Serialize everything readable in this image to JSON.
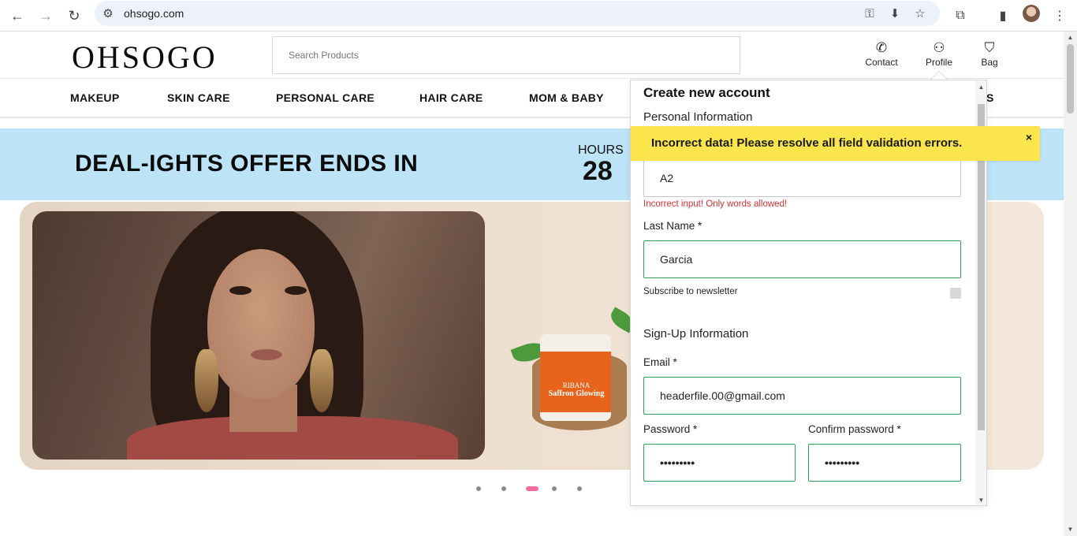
{
  "browser": {
    "url": "ohsogo.com"
  },
  "site": {
    "logo": "OHSOGO",
    "search_placeholder": "Search Products",
    "header_links": [
      {
        "label": "Contact",
        "icon": "phone-icon"
      },
      {
        "label": "Profile",
        "icon": "user-icon"
      },
      {
        "label": "Bag",
        "icon": "bag-icon"
      }
    ],
    "menu": [
      "MAKEUP",
      "SKIN CARE",
      "PERSONAL CARE",
      "HAIR CARE",
      "MOM & BABY",
      "S"
    ]
  },
  "deal": {
    "title": "DEAL-IGHTS OFFER ENDS IN",
    "hours_label": "HOURS",
    "hours_value": "28"
  },
  "banner": {
    "jar_label_brand": "RIBANA",
    "jar_label_product": "Saffron Glowing",
    "active_slide": 3,
    "slide_count": 5
  },
  "account_popup": {
    "title": "Create new account",
    "personal_section": "Personal Information",
    "first_name_value": "A2",
    "first_name_error": "Incorrect input! Only words allowed!",
    "last_name_label": "Last Name *",
    "last_name_value": "Garcia",
    "newsletter_label": "Subscribe to newsletter",
    "signup_section": "Sign-Up Information",
    "email_label": "Email *",
    "email_value": "headerfile.00@gmail.com",
    "password_label": "Password *",
    "password_value": "•••••••••",
    "confirm_password_label": "Confirm password *",
    "confirm_password_value": "•••••••••"
  },
  "toast": {
    "message": "Incorrect data! Please resolve all field validation errors.",
    "close": "×"
  },
  "colors": {
    "deal_bg": "#bde3f7",
    "toast_bg": "#fbe54c",
    "valid_border": "#2e9e5b",
    "error_text": "#d33030",
    "accent_pink": "#f36ca1"
  }
}
